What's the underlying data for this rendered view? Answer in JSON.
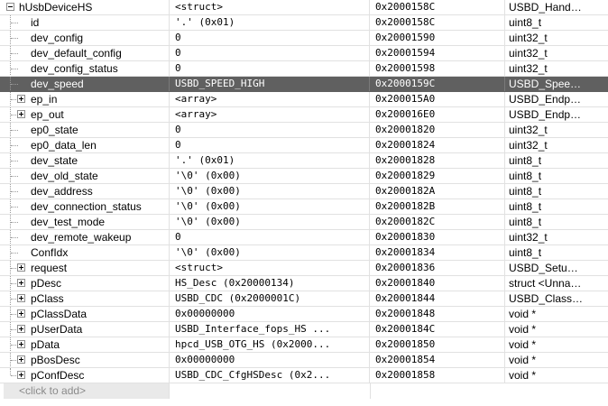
{
  "watch": {
    "rows": [
      {
        "name": "hUsbDeviceHS",
        "value": "<struct>",
        "location": "0x2000158C",
        "type": "USBD_Hand…",
        "level": 0,
        "expander": "minus"
      },
      {
        "name": "id",
        "value": "'.' (0x01)",
        "location": "0x2000158C",
        "type": "uint8_t",
        "level": 1,
        "expander": ""
      },
      {
        "name": "dev_config",
        "value": "0",
        "location": "0x20001590",
        "type": "uint32_t",
        "level": 1,
        "expander": ""
      },
      {
        "name": "dev_default_config",
        "value": "0",
        "location": "0x20001594",
        "type": "uint32_t",
        "level": 1,
        "expander": ""
      },
      {
        "name": "dev_config_status",
        "value": "0",
        "location": "0x20001598",
        "type": "uint32_t",
        "level": 1,
        "expander": ""
      },
      {
        "name": "dev_speed",
        "value": "USBD_SPEED_HIGH",
        "location": "0x2000159C",
        "type": "USBD_Spee…",
        "level": 1,
        "expander": "",
        "selected": true
      },
      {
        "name": "ep_in",
        "value": "<array>",
        "location": "0x200015A0",
        "type": "USBD_Endp…",
        "level": 1,
        "expander": "plus"
      },
      {
        "name": "ep_out",
        "value": "<array>",
        "location": "0x200016E0",
        "type": "USBD_Endp…",
        "level": 1,
        "expander": "plus"
      },
      {
        "name": "ep0_state",
        "value": "0",
        "location": "0x20001820",
        "type": "uint32_t",
        "level": 1,
        "expander": ""
      },
      {
        "name": "ep0_data_len",
        "value": "0",
        "location": "0x20001824",
        "type": "uint32_t",
        "level": 1,
        "expander": ""
      },
      {
        "name": "dev_state",
        "value": "'.' (0x01)",
        "location": "0x20001828",
        "type": "uint8_t",
        "level": 1,
        "expander": ""
      },
      {
        "name": "dev_old_state",
        "value": "'\\0' (0x00)",
        "location": "0x20001829",
        "type": "uint8_t",
        "level": 1,
        "expander": ""
      },
      {
        "name": "dev_address",
        "value": "'\\0' (0x00)",
        "location": "0x2000182A",
        "type": "uint8_t",
        "level": 1,
        "expander": ""
      },
      {
        "name": "dev_connection_status",
        "value": "'\\0' (0x00)",
        "location": "0x2000182B",
        "type": "uint8_t",
        "level": 1,
        "expander": ""
      },
      {
        "name": "dev_test_mode",
        "value": "'\\0' (0x00)",
        "location": "0x2000182C",
        "type": "uint8_t",
        "level": 1,
        "expander": ""
      },
      {
        "name": "dev_remote_wakeup",
        "value": "0",
        "location": "0x20001830",
        "type": "uint32_t",
        "level": 1,
        "expander": ""
      },
      {
        "name": "ConfIdx",
        "value": "'\\0' (0x00)",
        "location": "0x20001834",
        "type": "uint8_t",
        "level": 1,
        "expander": ""
      },
      {
        "name": "request",
        "value": "<struct>",
        "location": "0x20001836",
        "type": "USBD_Setu…",
        "level": 1,
        "expander": "plus"
      },
      {
        "name": "pDesc",
        "value": "HS_Desc (0x20000134)",
        "location": "0x20001840",
        "type": "struct <Unna…",
        "level": 1,
        "expander": "plus"
      },
      {
        "name": "pClass",
        "value": "USBD_CDC (0x2000001C)",
        "location": "0x20001844",
        "type": "USBD_Class…",
        "level": 1,
        "expander": "plus"
      },
      {
        "name": "pClassData",
        "value": "0x00000000",
        "location": "0x20001848",
        "type": "void *",
        "level": 1,
        "expander": "plus"
      },
      {
        "name": "pUserData",
        "value": "USBD_Interface_fops_HS ...",
        "location": "0x2000184C",
        "type": "void *",
        "level": 1,
        "expander": "plus"
      },
      {
        "name": "pData",
        "value": "hpcd_USB_OTG_HS (0x2000...",
        "location": "0x20001850",
        "type": "void *",
        "level": 1,
        "expander": "plus"
      },
      {
        "name": "pBosDesc",
        "value": "0x00000000",
        "location": "0x20001854",
        "type": "void *",
        "level": 1,
        "expander": "plus"
      },
      {
        "name": "pConfDesc",
        "value": "USBD_CDC_CfgHSDesc (0x2...",
        "location": "0x20001858",
        "type": "void *",
        "level": 1,
        "expander": "plus"
      }
    ],
    "add_placeholder": "<click to add>"
  }
}
